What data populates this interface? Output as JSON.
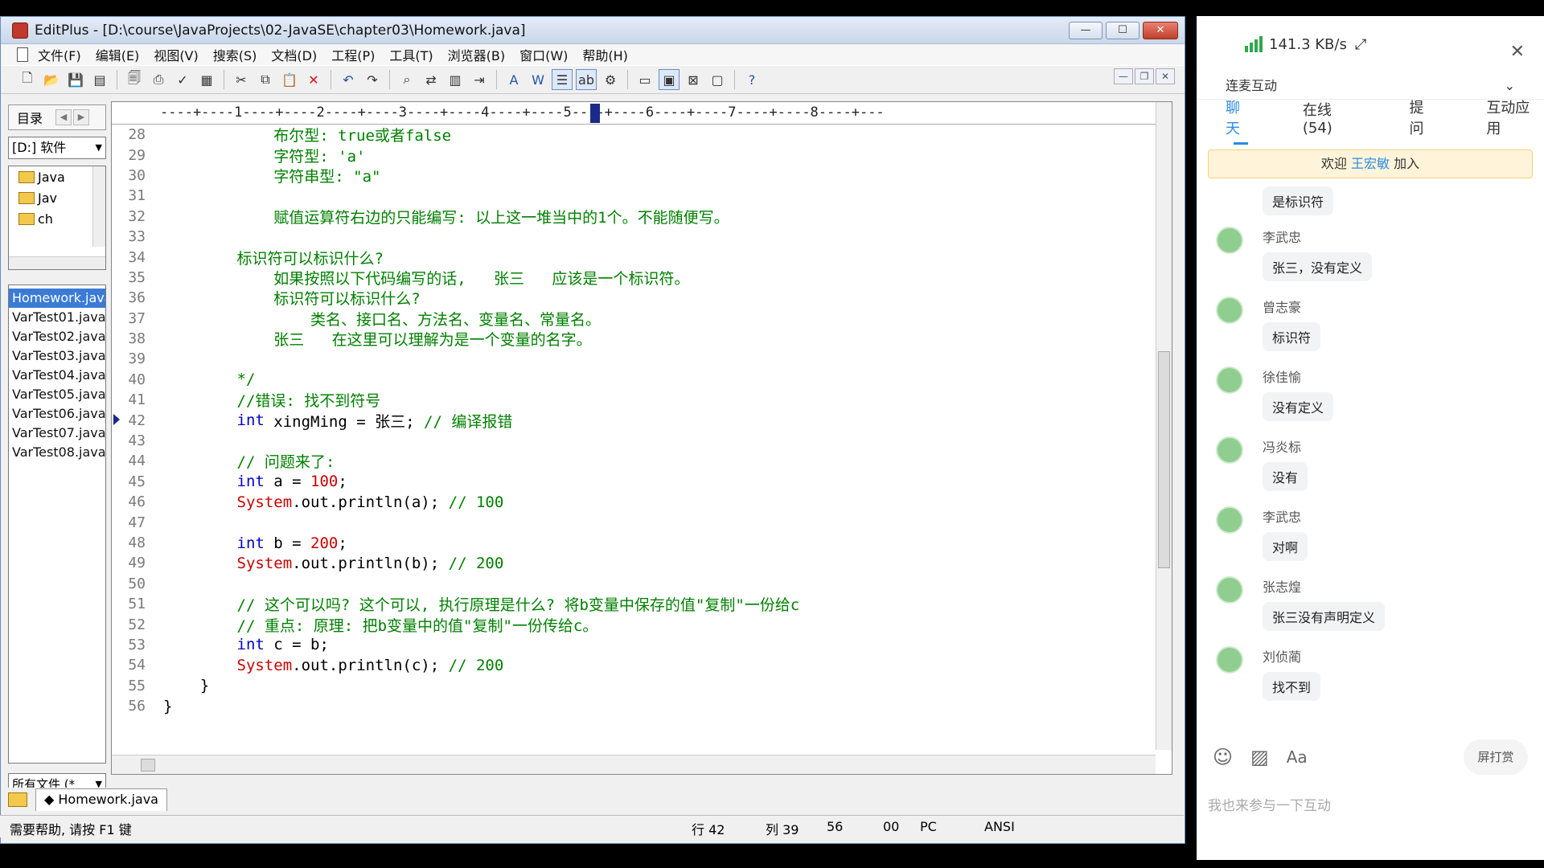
{
  "window": {
    "title": "EditPlus - [D:\\course\\JavaProjects\\02-JavaSE\\chapter03\\Homework.java]",
    "min": "—",
    "max": "☐",
    "close": "✕"
  },
  "menu": [
    "文件(F)",
    "编辑(E)",
    "视图(V)",
    "搜索(S)",
    "文档(D)",
    "工程(P)",
    "工具(T)",
    "浏览器(B)",
    "窗口(W)",
    "帮助(H)"
  ],
  "left": {
    "dir_tab": "目录",
    "drive": "[D:] 软件",
    "tree": [
      "Java",
      "Jav",
      "ch"
    ],
    "files": [
      "Homework.java",
      "VarTest01.java",
      "VarTest02.java",
      "VarTest03.java",
      "VarTest04.java",
      "VarTest05.java",
      "VarTest06.java",
      "VarTest07.java",
      "VarTest08.java"
    ],
    "filter": "所有文件 (*"
  },
  "ruler": "----+----1----+----2----+----3----+----4----+----5----+----6----+----7----+----8----+---",
  "code": [
    {
      "n": "28",
      "t": [
        [
          "comment",
          "            布尔型: true或者false"
        ]
      ]
    },
    {
      "n": "29",
      "t": [
        [
          "comment",
          "            字符型: 'a'"
        ]
      ]
    },
    {
      "n": "30",
      "t": [
        [
          "comment",
          "            字符串型: \"a\""
        ]
      ]
    },
    {
      "n": "31",
      "t": []
    },
    {
      "n": "32",
      "t": [
        [
          "comment",
          "            赋值运算符右边的只能编写: 以上这一堆当中的1个。不能随便写。"
        ]
      ]
    },
    {
      "n": "33",
      "t": []
    },
    {
      "n": "34",
      "t": [
        [
          "comment",
          "        标识符可以标识什么?"
        ]
      ]
    },
    {
      "n": "35",
      "t": [
        [
          "comment",
          "            如果按照以下代码编写的话,   张三   应该是一个标识符。"
        ]
      ]
    },
    {
      "n": "36",
      "t": [
        [
          "comment",
          "            标识符可以标识什么?"
        ]
      ]
    },
    {
      "n": "37",
      "t": [
        [
          "comment",
          "                类名、接口名、方法名、变量名、常量名。"
        ]
      ]
    },
    {
      "n": "38",
      "t": [
        [
          "comment",
          "            张三   在这里可以理解为是一个变量的名字。"
        ]
      ]
    },
    {
      "n": "39",
      "t": []
    },
    {
      "n": "40",
      "t": [
        [
          "comment",
          "        */"
        ]
      ]
    },
    {
      "n": "41",
      "t": [
        [
          "comment",
          "        //错误: 找不到符号"
        ]
      ]
    },
    {
      "n": "42",
      "t": [
        [
          "keyword",
          "        int"
        ],
        [
          "text",
          " xingMing = 张三; "
        ],
        [
          "comment",
          "// 编译报错"
        ]
      ]
    },
    {
      "n": "43",
      "t": []
    },
    {
      "n": "44",
      "t": [
        [
          "comment",
          "        // 问题来了:"
        ]
      ]
    },
    {
      "n": "45",
      "t": [
        [
          "keyword",
          "        int"
        ],
        [
          "text",
          " a = "
        ],
        [
          "num",
          "100"
        ],
        [
          "text",
          ";"
        ]
      ]
    },
    {
      "n": "46",
      "t": [
        [
          "class",
          "        System"
        ],
        [
          "text",
          ".out.println(a); "
        ],
        [
          "comment",
          "// 100"
        ]
      ]
    },
    {
      "n": "47",
      "t": []
    },
    {
      "n": "48",
      "t": [
        [
          "keyword",
          "        int"
        ],
        [
          "text",
          " b = "
        ],
        [
          "num",
          "200"
        ],
        [
          "text",
          ";"
        ]
      ]
    },
    {
      "n": "49",
      "t": [
        [
          "class",
          "        System"
        ],
        [
          "text",
          ".out.println(b); "
        ],
        [
          "comment",
          "// 200"
        ]
      ]
    },
    {
      "n": "50",
      "t": []
    },
    {
      "n": "51",
      "t": [
        [
          "comment",
          "        // 这个可以吗? 这个可以, 执行原理是什么? 将b变量中保存的值\"复制\"一份给c"
        ]
      ]
    },
    {
      "n": "52",
      "t": [
        [
          "comment",
          "        // 重点: 原理: 把b变量中的值\"复制\"一份传给c。"
        ]
      ]
    },
    {
      "n": "53",
      "t": [
        [
          "keyword",
          "        int"
        ],
        [
          "text",
          " c = b;"
        ]
      ]
    },
    {
      "n": "54",
      "t": [
        [
          "class",
          "        System"
        ],
        [
          "text",
          ".out.println(c); "
        ],
        [
          "comment",
          "// 200"
        ]
      ]
    },
    {
      "n": "55",
      "t": [
        [
          "text",
          "    }"
        ]
      ]
    },
    {
      "n": "56",
      "t": [
        [
          "text",
          "}"
        ]
      ]
    }
  ],
  "doc_tab": "◆ Homework.java",
  "status": {
    "help": "需要帮助, 请按 F1 键",
    "row": "行 42",
    "col": "列 39",
    "lines": "56",
    "code": "00",
    "mode": "PC",
    "encoding": "ANSI"
  },
  "chat": {
    "speed": "141.3 KB/s",
    "collapse": "连麦互动",
    "tabs": [
      "聊天",
      "在线(54)",
      "提问",
      "互动应用"
    ],
    "welcome_prefix": "欢迎 ",
    "welcome_name": "王宏敏",
    "welcome_suffix": " 加入",
    "first_bubble": "是标识符",
    "messages": [
      {
        "name": "李武忠",
        "text": "张三，没有定义"
      },
      {
        "name": "曾志豪",
        "text": "标识符"
      },
      {
        "name": "徐佳愉",
        "text": "没有定义"
      },
      {
        "name": "冯炎标",
        "text": "没有"
      },
      {
        "name": "李武忠",
        "text": "对啊"
      },
      {
        "name": "张志煌",
        "text": "张三没有声明定义"
      },
      {
        "name": "刘侦蔺",
        "text": "找不到"
      }
    ],
    "reward": "屏打赏",
    "input_placeholder": "我也来参与一下互动"
  }
}
